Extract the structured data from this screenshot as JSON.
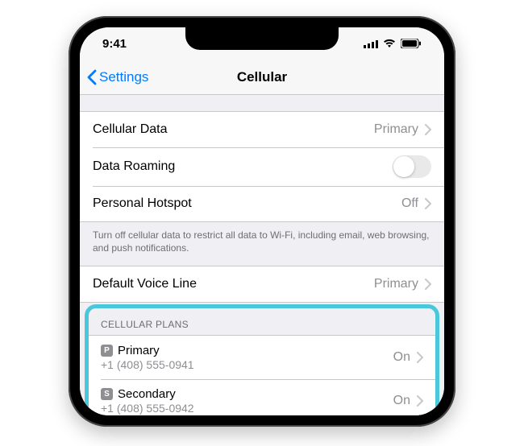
{
  "status": {
    "time": "9:41"
  },
  "nav": {
    "back_label": "Settings",
    "title": "Cellular"
  },
  "rows": {
    "cellular_data": {
      "label": "Cellular Data",
      "value": "Primary"
    },
    "data_roaming": {
      "label": "Data Roaming"
    },
    "personal_hotspot": {
      "label": "Personal Hotspot",
      "value": "Off"
    },
    "default_voice_line": {
      "label": "Default Voice Line",
      "value": "Primary"
    }
  },
  "footer": "Turn off cellular data to restrict all data to Wi-Fi, including email, web browsing, and push notifications.",
  "plans_header": "CELLULAR PLANS",
  "plans": [
    {
      "badge": "P",
      "name": "Primary",
      "number": "+1 (408) 555-0941",
      "status": "On"
    },
    {
      "badge": "S",
      "name": "Secondary",
      "number": "+1 (408) 555-0942",
      "status": "On"
    }
  ]
}
